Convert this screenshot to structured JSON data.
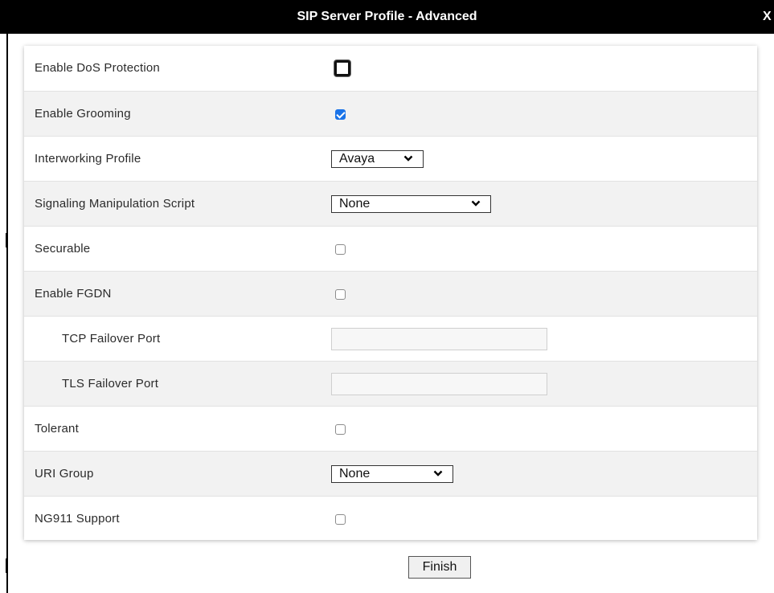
{
  "window": {
    "title": "SIP Server Profile - Advanced",
    "close_label": "X"
  },
  "form": {
    "rows": [
      {
        "label": "Enable DoS Protection",
        "control": "checkbox",
        "checked": false
      },
      {
        "label": "Enable Grooming",
        "control": "checkbox",
        "checked": true
      },
      {
        "label": "Interworking Profile",
        "control": "select",
        "value": "Avaya"
      },
      {
        "label": "Signaling Manipulation Script",
        "control": "select",
        "value": "None"
      },
      {
        "label": "Securable",
        "control": "checkbox",
        "checked": false
      },
      {
        "label": "Enable FGDN",
        "control": "checkbox",
        "checked": false
      },
      {
        "label": "TCP Failover Port",
        "control": "text",
        "value": ""
      },
      {
        "label": "TLS Failover Port",
        "control": "text",
        "value": ""
      },
      {
        "label": "Tolerant",
        "control": "checkbox",
        "checked": false
      },
      {
        "label": "URI Group",
        "control": "select",
        "value": "None"
      },
      {
        "label": "NG911 Support",
        "control": "checkbox",
        "checked": false
      }
    ]
  },
  "footer": {
    "finish_label": "Finish"
  },
  "colors": {
    "titlebar": "#000000",
    "checkbox_checked": "#1a73e8",
    "row_alt": "#f2f2f2"
  }
}
